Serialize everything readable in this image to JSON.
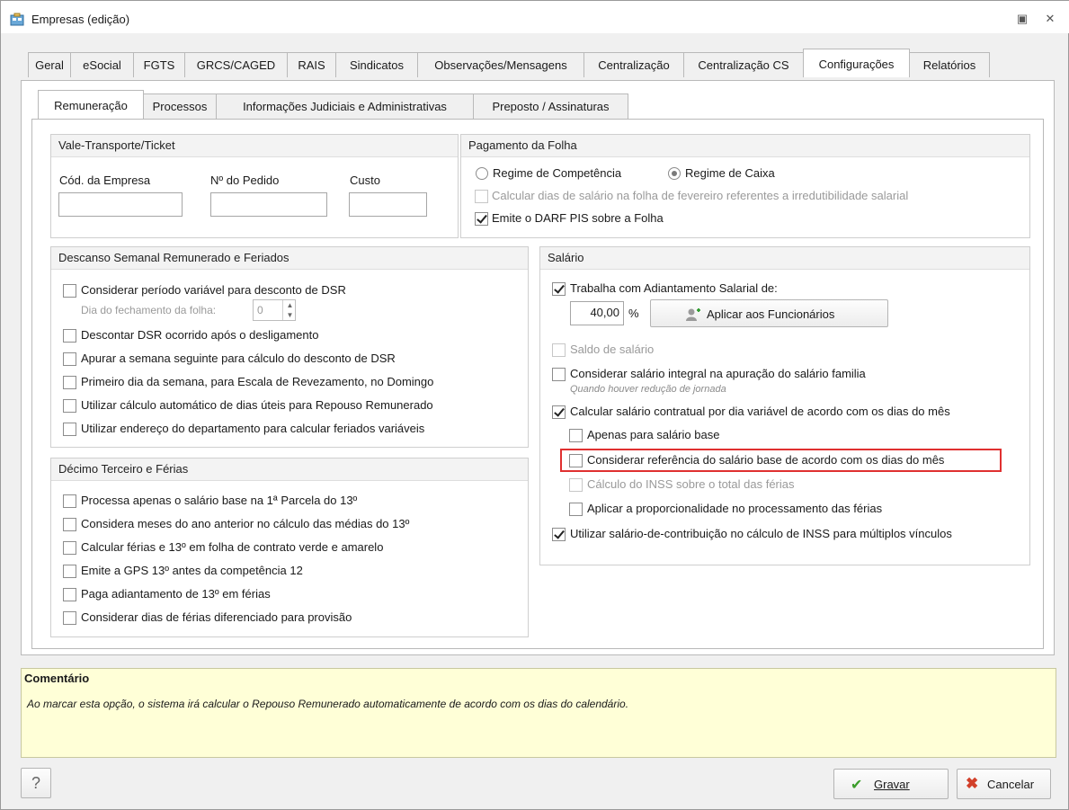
{
  "window": {
    "title": "Empresas (edição)"
  },
  "top_tabs": [
    "Geral",
    "eSocial",
    "FGTS",
    "GRCS/CAGED",
    "RAIS",
    "Sindicatos",
    "Observações/Mensagens",
    "Centralização",
    "Centralização CS",
    "Configurações",
    "Relatórios"
  ],
  "sub_tabs": [
    "Remuneração",
    "Processos",
    "Informações Judiciais e Administrativas",
    "Preposto / Assinaturas"
  ],
  "vale": {
    "title": "Vale-Transporte/Ticket",
    "cod_label": "Cód. da Empresa",
    "pedido_label": "Nº do Pedido",
    "custo_label": "Custo",
    "cod_value": "",
    "pedido_value": "",
    "custo_value": ""
  },
  "pagamento": {
    "title": "Pagamento da Folha",
    "radio_competencia": "Regime de Competência",
    "radio_caixa": "Regime de Caixa",
    "calc_fev": "Calcular dias de salário na folha de fevereiro referentes a irredutibilidade salarial",
    "darf_pis": "Emite o DARF PIS sobre a Folha"
  },
  "dsr": {
    "title": "Descanso Semanal Remunerado e Feriados",
    "periodo_variavel": "Considerar período variável para desconto de DSR",
    "dia_fechamento": "Dia do fechamento da folha:",
    "dia_value": "0",
    "descontar": "Descontar DSR ocorrido após o desligamento",
    "apurar": "Apurar a semana seguinte para cálculo do desconto de DSR",
    "primeiro_dia": "Primeiro dia da semana, para Escala de Revezamento, no Domingo",
    "calc_auto": "Utilizar cálculo automático de dias úteis para Repouso Remunerado",
    "endereco": "Utilizar endereço do departamento para calcular feriados variáveis"
  },
  "decimo": {
    "title": "Décimo Terceiro e Férias",
    "items": [
      "Processa apenas o salário base na 1ª Parcela do 13º",
      "Considera meses do ano anterior no cálculo das médias do 13º",
      "Calcular férias e 13º em folha de contrato verde e amarelo",
      "Emite a GPS 13º antes da competência 12",
      "Paga adiantamento de 13º em férias",
      "Considerar dias de férias diferenciado para provisão"
    ]
  },
  "salario": {
    "title": "Salário",
    "adiantamento": "Trabalha com Adiantamento Salarial de:",
    "percent_value": "40,00",
    "percent_sign": "%",
    "aplicar": "Aplicar aos Funcionários",
    "saldo": "Saldo de salário",
    "integral": "Considerar salário integral na apuração do salário familia",
    "integral_hint": "Quando houver redução de jornada",
    "contratual": "Calcular salário contratual por dia variável de acordo com os dias do mês",
    "apenas_base": "Apenas para salário base",
    "referencia": "Considerar referência do salário base de acordo com os dias do mês",
    "inss_ferias": "Cálculo do INSS sobre o total das férias",
    "proporcionalidade": "Aplicar a proporcionalidade no processamento das férias",
    "contribuicao": "Utilizar salário-de-contribuição no cálculo de INSS para múltiplos vínculos"
  },
  "comment": {
    "title": "Comentário",
    "text": "Ao marcar esta opção, o sistema irá calcular o Repouso Remunerado automaticamente de acordo com os dias do calendário."
  },
  "footer": {
    "help": "?",
    "gravar": "Gravar",
    "cancelar": "Cancelar"
  },
  "colors": {
    "highlight": "#e03030",
    "comment_bg": "#ffffd7"
  }
}
